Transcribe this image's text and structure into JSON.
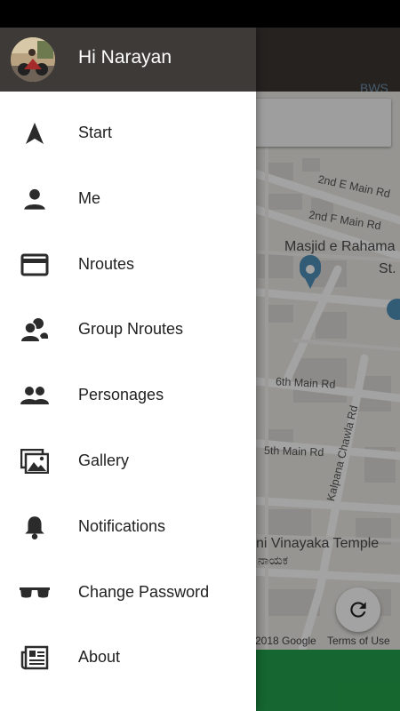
{
  "drawer": {
    "greeting": "Hi Narayan",
    "items": [
      {
        "label": "Start",
        "icon": "navigation-arrow-icon"
      },
      {
        "label": "Me",
        "icon": "person-icon"
      },
      {
        "label": "Nroutes",
        "icon": "credit-card-icon"
      },
      {
        "label": "Group Nroutes",
        "icon": "group-chat-icon"
      },
      {
        "label": "Personages",
        "icon": "people-icon"
      },
      {
        "label": "Gallery",
        "icon": "gallery-icon"
      },
      {
        "label": "Notifications",
        "icon": "bell-icon"
      },
      {
        "label": "Change Password",
        "icon": "sunglasses-icon"
      },
      {
        "label": "About",
        "icon": "newspaper-icon"
      }
    ]
  },
  "map": {
    "pois": [
      "Masjid e Rahama",
      "St. Kol",
      "ni Vinayaka Temple",
      "ನಾಯಕ"
    ],
    "roads": [
      "2nd E Main Rd",
      "2nd F Main Rd",
      "6th Main Rd",
      "5th Main Rd",
      "Kalpana Chawla Rd"
    ],
    "top_fragment": "BWS",
    "attribution_left": "2018 Google",
    "attribution_right": "Terms of Use"
  },
  "colors": {
    "header": "#3e3a37",
    "appbar": "#3a3633",
    "accent_green": "#22a04b",
    "poi_pin": "#4f8fb8"
  }
}
